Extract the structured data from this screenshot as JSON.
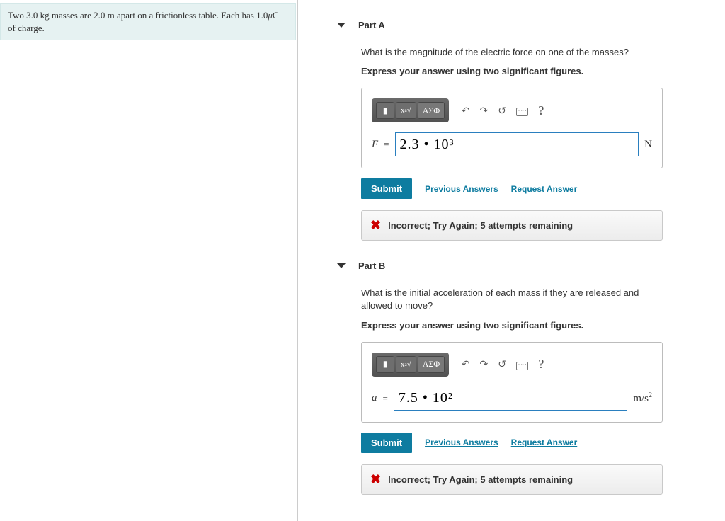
{
  "problem": "Two 3.0 kg masses are 2.0 m apart on a frictionless table. Each has 1.0μC of charge.",
  "toolbar": {
    "templates_label": "√□",
    "greek_label": "ΑΣΦ",
    "undo": "↶",
    "redo": "↷",
    "reset": "↺",
    "keyboard": "⌨",
    "help": "?"
  },
  "buttons": {
    "submit": "Submit",
    "prev": "Previous Answers",
    "request": "Request Answer"
  },
  "partA": {
    "title": "Part A",
    "prompt": "What is the magnitude of the electric force on one of the masses?",
    "instruction": "Express your answer using two significant figures.",
    "var": "F",
    "eq": "=",
    "value": "2.3 • 10³",
    "unit": "N",
    "feedback": "Incorrect; Try Again; 5 attempts remaining"
  },
  "partB": {
    "title": "Part B",
    "prompt": "What is the initial acceleration of each mass if they are released and allowed to move?",
    "instruction": "Express your answer using two significant figures.",
    "var": "a",
    "eq": "=",
    "value": "7.5 • 10²",
    "unit_html": "m/s²",
    "feedback": "Incorrect; Try Again; 5 attempts remaining"
  }
}
